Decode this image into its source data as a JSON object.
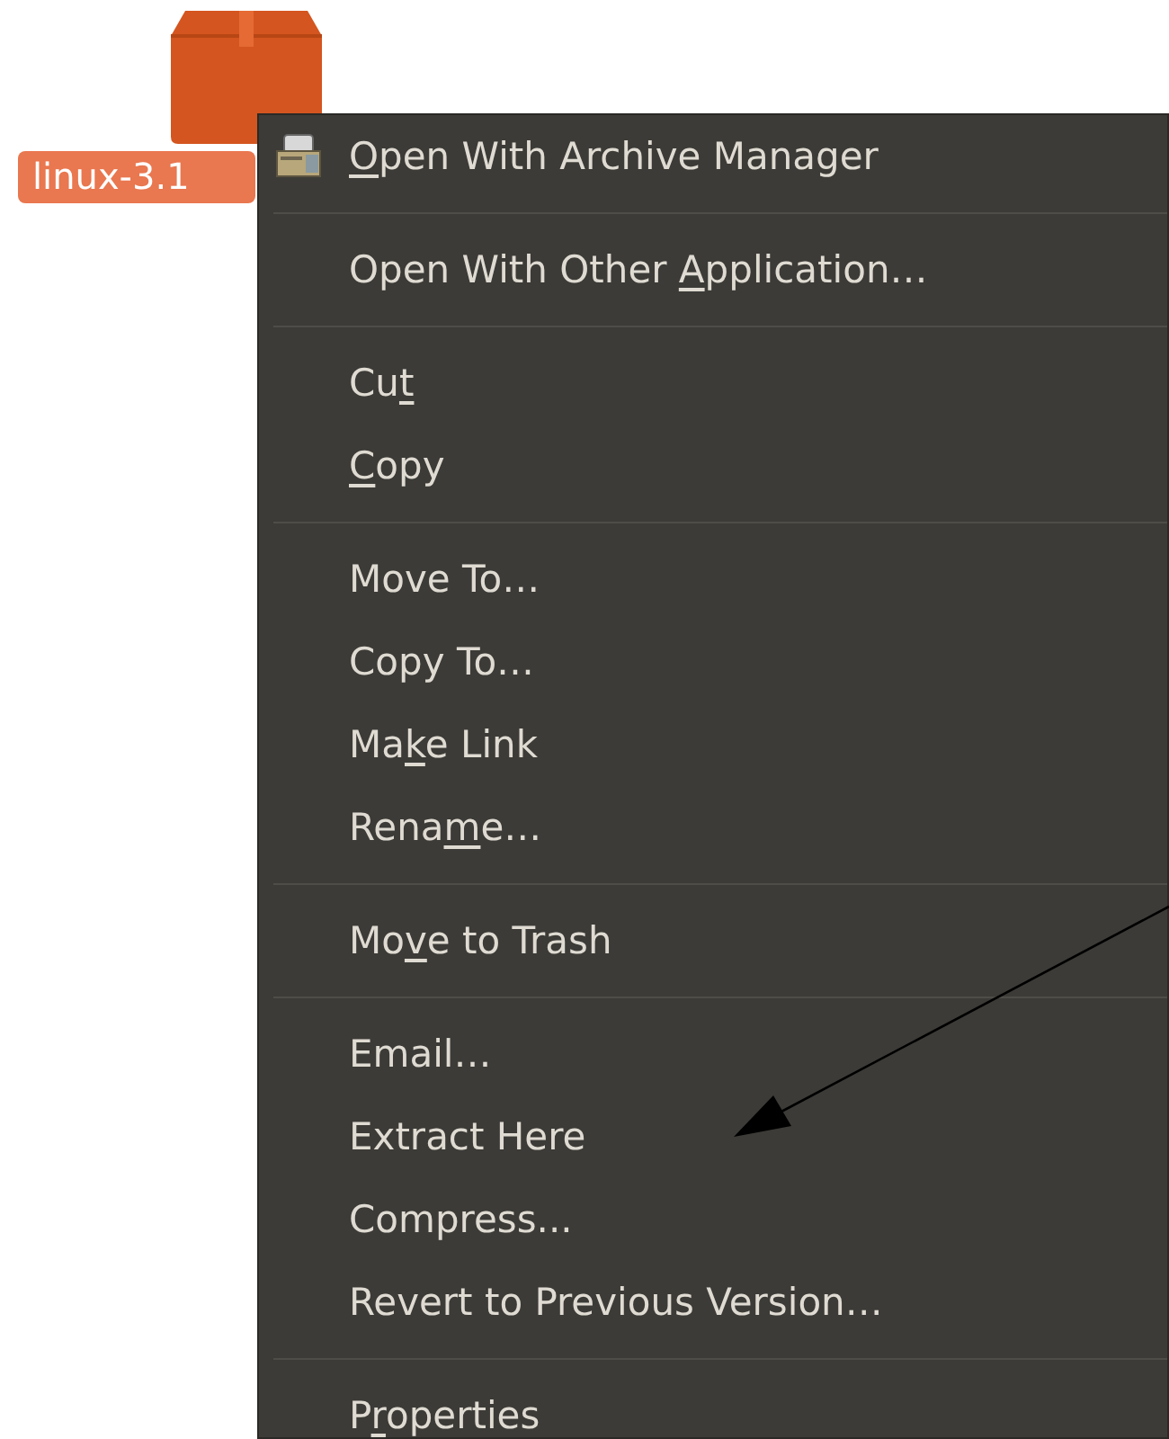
{
  "desktop_item": {
    "label": "linux-3.1"
  },
  "menu": {
    "groups": [
      [
        {
          "kind": "with-icon",
          "key": "O",
          "after": "pen With Archive Manager"
        }
      ],
      [
        {
          "kind": "plain",
          "before": "Open With Other ",
          "key": "A",
          "after": "pplication…"
        }
      ],
      [
        {
          "kind": "plain",
          "before": "Cu",
          "key": "t"
        },
        {
          "kind": "plain",
          "key": "C",
          "after": "opy"
        }
      ],
      [
        {
          "kind": "plain",
          "before": "Move To…"
        },
        {
          "kind": "plain",
          "before": "Copy To…"
        },
        {
          "kind": "plain",
          "before": "Ma",
          "key": "k",
          "after": "e Link"
        },
        {
          "kind": "plain",
          "before": "Rena",
          "key": "m",
          "after": "e…"
        }
      ],
      [
        {
          "kind": "plain",
          "before": "Mo",
          "key": "v",
          "after": "e to Trash"
        }
      ],
      [
        {
          "kind": "plain",
          "before": "Email…"
        },
        {
          "kind": "plain",
          "before": "Extract Here"
        },
        {
          "kind": "plain",
          "before": "Compress..."
        },
        {
          "kind": "plain",
          "before": "Revert to Previous Version…"
        }
      ],
      [
        {
          "kind": "plain",
          "before": "P",
          "key": "r",
          "after": "operties"
        }
      ]
    ]
  }
}
